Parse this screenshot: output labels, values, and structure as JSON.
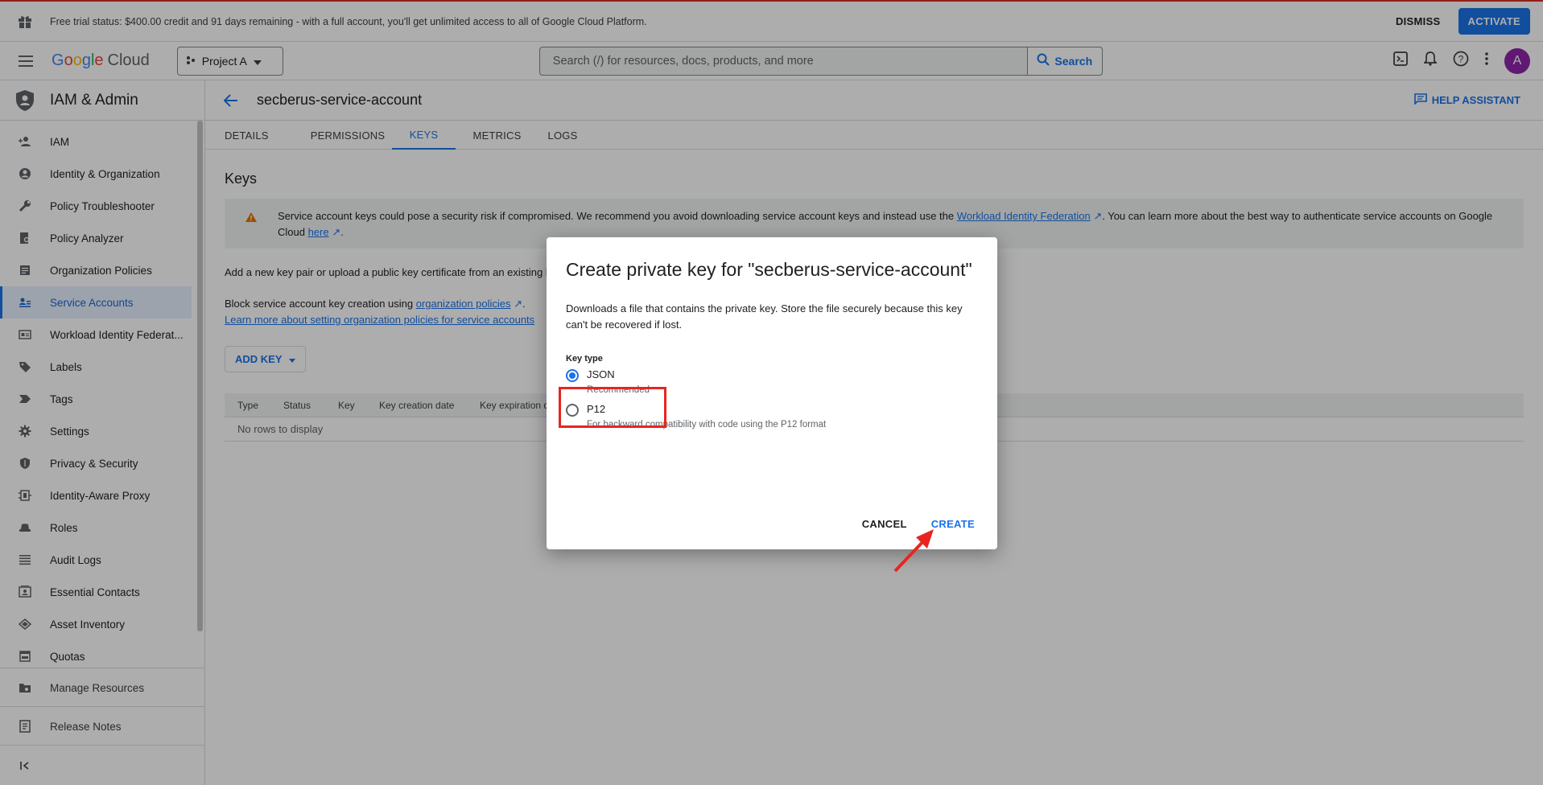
{
  "trial": {
    "message": "Free trial status: $400.00 credit and 91 days remaining - with a full account, you'll get unlimited access to all of Google Cloud Platform.",
    "dismiss": "DISMISS",
    "activate": "ACTIVATE"
  },
  "header": {
    "logo_google": [
      "G",
      "o",
      "o",
      "g",
      "l",
      "e"
    ],
    "logo_cloud": "Cloud",
    "project": "Project A",
    "search_placeholder": "Search (/) for resources, docs, products, and more",
    "search_button": "Search",
    "avatar_letter": "A"
  },
  "sidebar": {
    "title": "IAM & Admin",
    "items": [
      {
        "label": "IAM",
        "icon": "person-add-icon"
      },
      {
        "label": "Identity & Organization",
        "icon": "account-circle-icon"
      },
      {
        "label": "Policy Troubleshooter",
        "icon": "wrench-icon"
      },
      {
        "label": "Policy Analyzer",
        "icon": "document-search-icon"
      },
      {
        "label": "Organization Policies",
        "icon": "list-document-icon"
      },
      {
        "label": "Service Accounts",
        "icon": "service-account-icon",
        "active": true
      },
      {
        "label": "Workload Identity Federat...",
        "icon": "id-card-icon"
      },
      {
        "label": "Labels",
        "icon": "label-icon"
      },
      {
        "label": "Tags",
        "icon": "tag-arrow-icon"
      },
      {
        "label": "Settings",
        "icon": "gear-icon"
      },
      {
        "label": "Privacy & Security",
        "icon": "shield-icon"
      },
      {
        "label": "Identity-Aware Proxy",
        "icon": "proxy-icon"
      },
      {
        "label": "Roles",
        "icon": "hat-icon"
      },
      {
        "label": "Audit Logs",
        "icon": "lines-icon"
      },
      {
        "label": "Essential Contacts",
        "icon": "contacts-icon"
      },
      {
        "label": "Asset Inventory",
        "icon": "diamond-icon"
      },
      {
        "label": "Quotas",
        "icon": "calendar-icon"
      }
    ],
    "footer": [
      {
        "label": "Manage Resources",
        "icon": "folder-gear-icon"
      },
      {
        "label": "Release Notes",
        "icon": "notes-icon"
      }
    ],
    "collapse_icon": "collapse-icon"
  },
  "page": {
    "title": "secberus-service-account",
    "help": "HELP ASSISTANT",
    "tabs": [
      "DETAILS",
      "PERMISSIONS",
      "KEYS",
      "METRICS",
      "LOGS"
    ],
    "active_tab": "KEYS",
    "section_title": "Keys",
    "warning_prefix": "Service account keys could pose a security risk if compromised. We recommend you avoid downloading service account keys and instead use the ",
    "warning_link1": "Workload Identity Federation",
    "warning_mid": ". You can learn more about the best way to authenticate service accounts on Google Cloud ",
    "warning_link2": "here",
    "warning_suffix": ".",
    "add_text": "Add a new key pair or upload a public key certificate from an existing k",
    "block_text": "Block service account key creation using ",
    "block_link": "organization policies",
    "learn_link": "Learn more about setting organization policies for service accounts",
    "add_key": "ADD KEY",
    "table_headers": [
      "Type",
      "Status",
      "Key",
      "Key creation date",
      "Key expiration d"
    ],
    "table_empty": "No rows to display"
  },
  "dialog": {
    "title": "Create private key for \"secberus-service-account\"",
    "description": "Downloads a file that contains the private key. Store the file securely because this key can't be recovered if lost.",
    "key_type_label": "Key type",
    "options": [
      {
        "label": "JSON",
        "sub": "Recommended",
        "checked": true
      },
      {
        "label": "P12",
        "sub": "For backward compatibility with code using the P12 format",
        "checked": false
      }
    ],
    "cancel": "CANCEL",
    "create": "CREATE"
  }
}
